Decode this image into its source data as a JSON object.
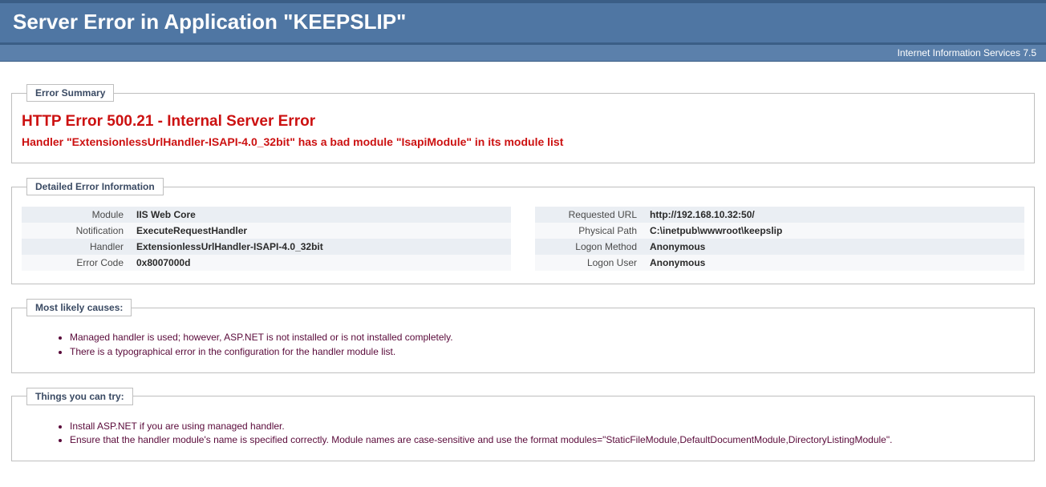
{
  "header": {
    "title": "Server Error in Application \"KEEPSLIP\"",
    "subtitle": "Internet Information Services 7.5"
  },
  "error_summary": {
    "legend": "Error Summary",
    "title": "HTTP Error 500.21 - Internal Server Error",
    "subtitle": "Handler \"ExtensionlessUrlHandler-ISAPI-4.0_32bit\" has a bad module \"IsapiModule\" in its module list"
  },
  "detailed": {
    "legend": "Detailed Error Information",
    "left": [
      {
        "label": "Module",
        "value": "IIS Web Core"
      },
      {
        "label": "Notification",
        "value": "ExecuteRequestHandler"
      },
      {
        "label": "Handler",
        "value": "ExtensionlessUrlHandler-ISAPI-4.0_32bit"
      },
      {
        "label": "Error Code",
        "value": "0x8007000d"
      }
    ],
    "right": [
      {
        "label": "Requested URL",
        "value": "http://192.168.10.32:50/"
      },
      {
        "label": "Physical Path",
        "value": "C:\\inetpub\\wwwroot\\keepslip"
      },
      {
        "label": "Logon Method",
        "value": "Anonymous"
      },
      {
        "label": "Logon User",
        "value": "Anonymous"
      }
    ]
  },
  "causes": {
    "legend": "Most likely causes:",
    "items": [
      "Managed handler is used; however, ASP.NET is not installed or is not installed completely.",
      "There is a typographical error in the configuration for the handler module list."
    ]
  },
  "try": {
    "legend": "Things you can try:",
    "items": [
      "Install ASP.NET if you are using managed handler.",
      "Ensure that the handler module's name is specified correctly. Module names are case-sensitive and use the format modules=\"StaticFileModule,DefaultDocumentModule,DirectoryListingModule\"."
    ]
  }
}
